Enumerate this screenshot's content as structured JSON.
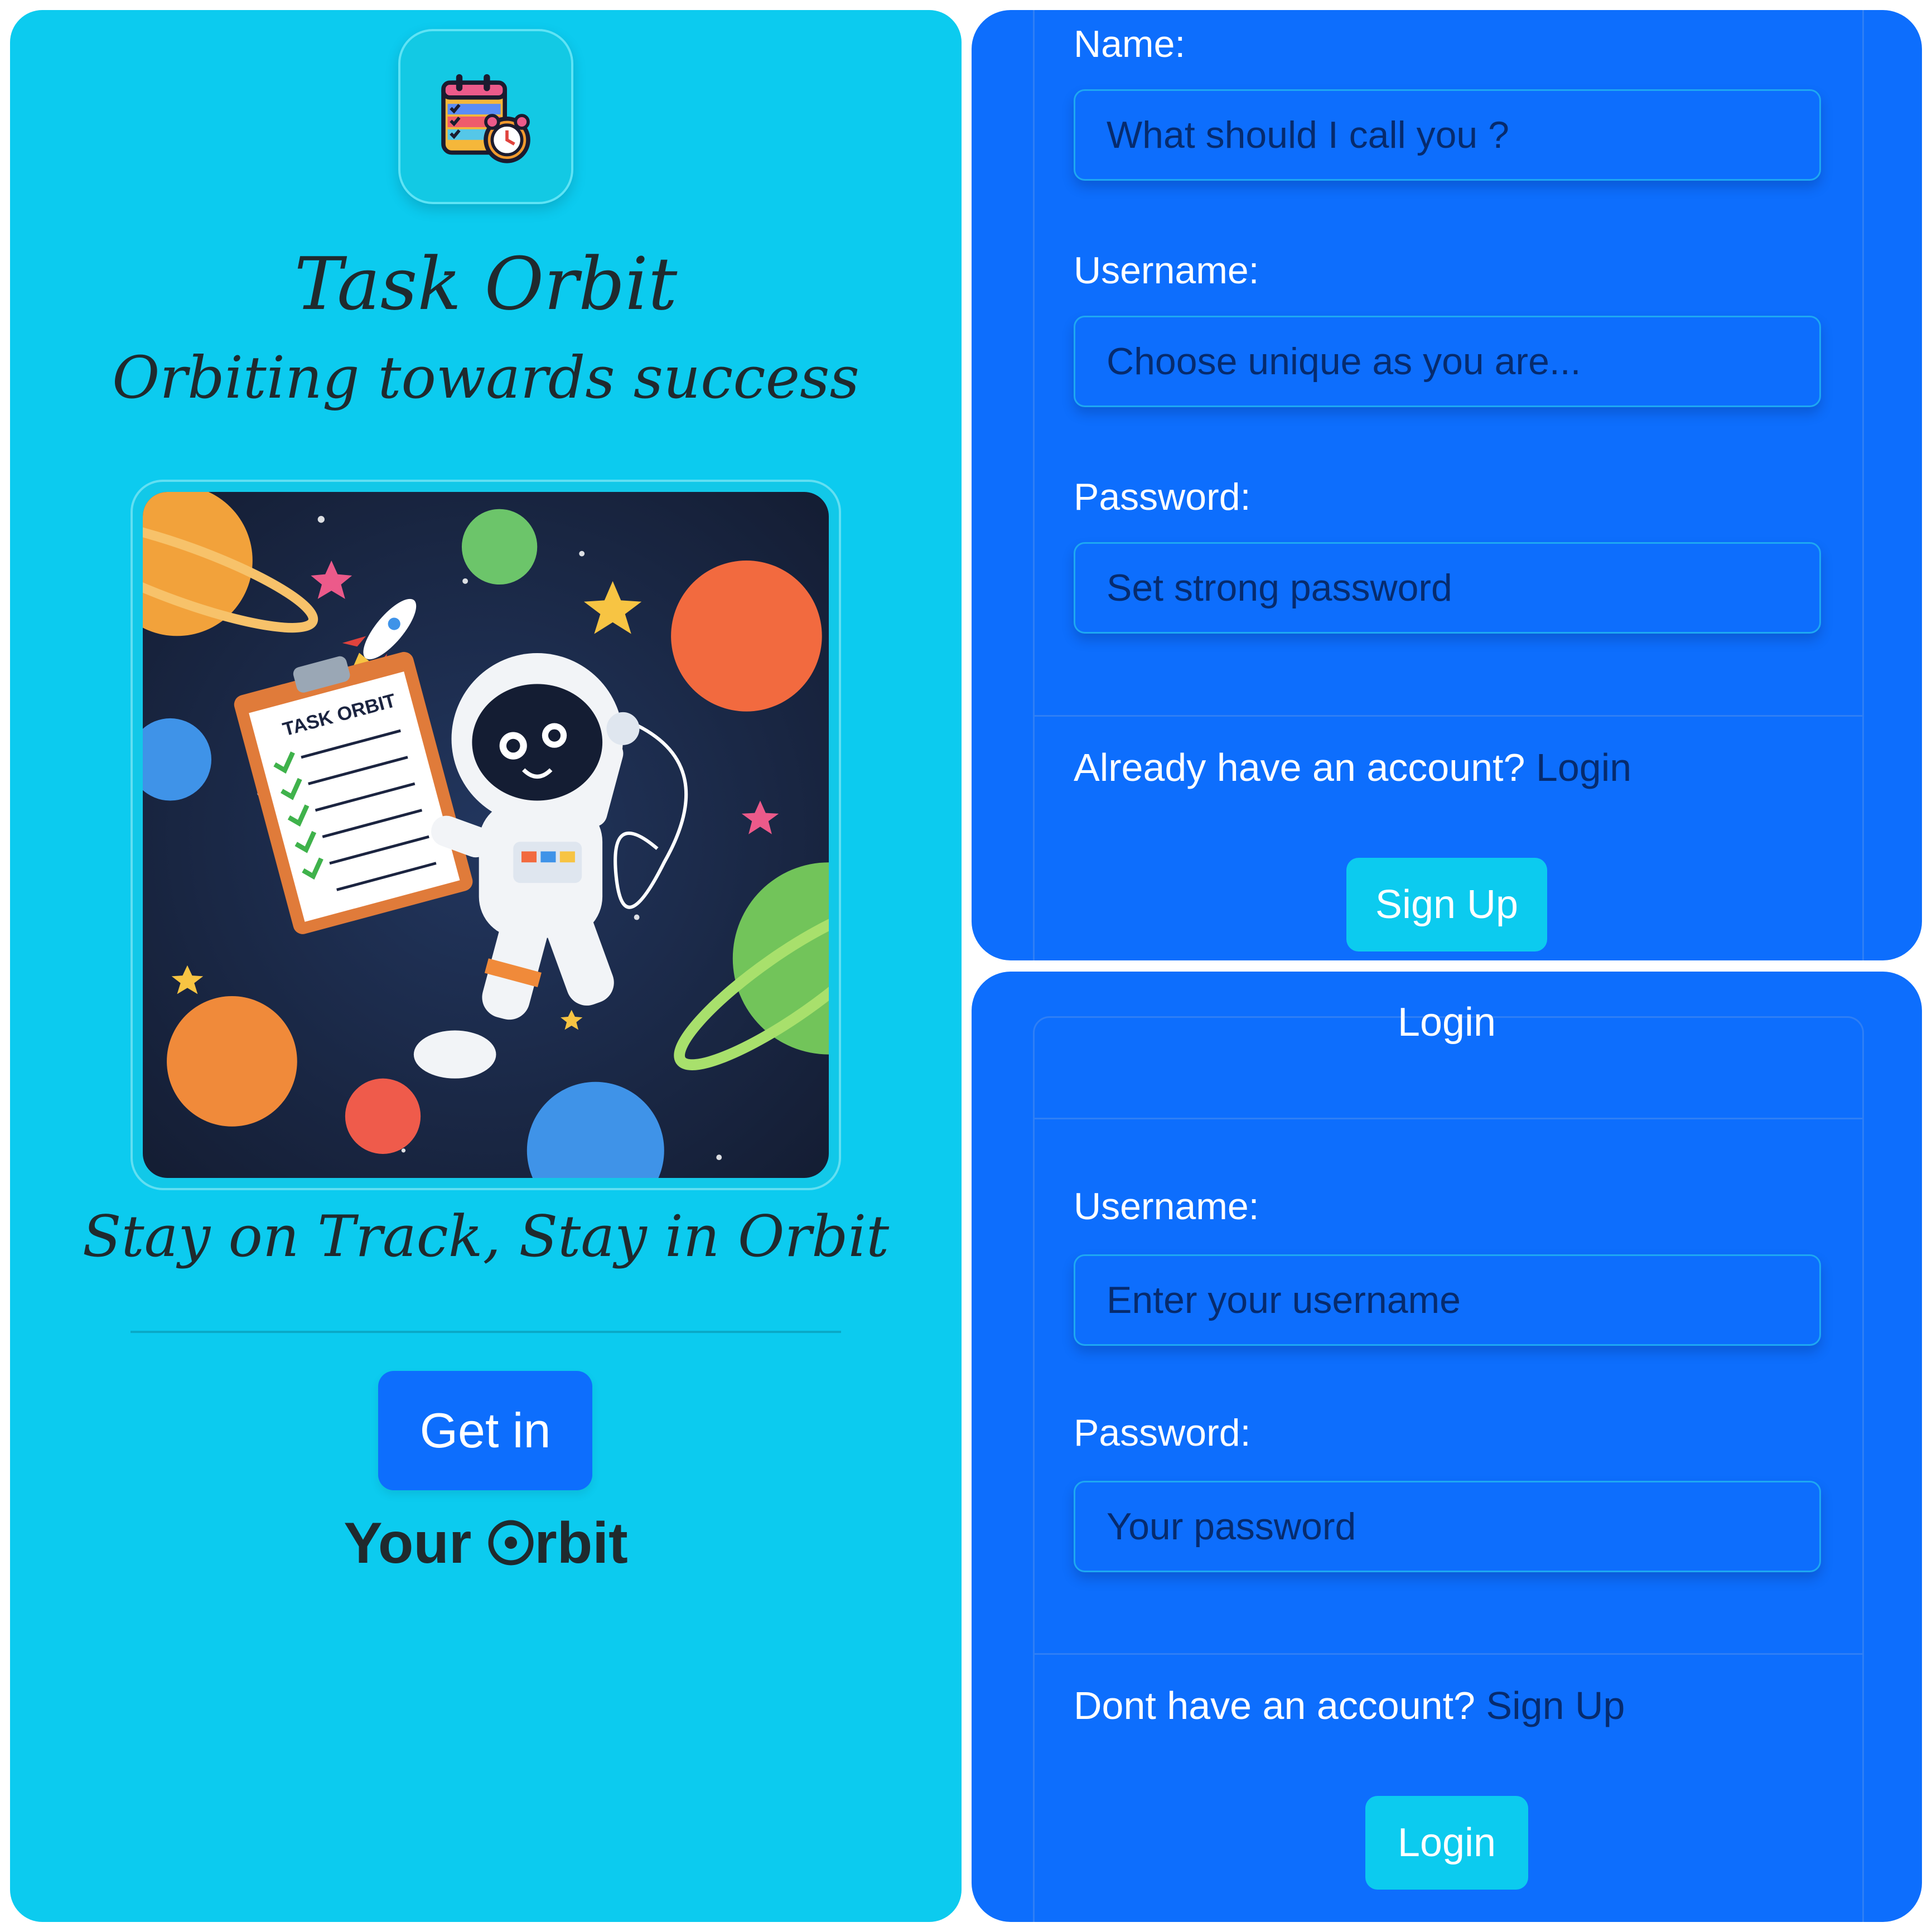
{
  "landing": {
    "title": "Task Orbit",
    "tagline": "Orbiting towards success",
    "clipboard_text": "TASK ORBIT",
    "caption": "Stay on Track, Stay in Orbit",
    "get_in_label": "Get in",
    "your_orbit_prefix": "Your ",
    "your_orbit_suffix": "rbit"
  },
  "signup_form": {
    "name_label": "Name:",
    "name_placeholder": "What should I call you ?",
    "username_label": "Username:",
    "username_placeholder": "Choose unique as you are...",
    "password_label": "Password:",
    "password_placeholder": "Set strong password",
    "account_prompt": "Already have an account?",
    "login_link": "Login",
    "submit_label": "Sign Up"
  },
  "login_form": {
    "header": "Login",
    "username_label": "Username:",
    "username_placeholder": "Enter your username",
    "password_label": "Password:",
    "password_placeholder": "Your password",
    "account_prompt": "Dont have an account?",
    "signup_link": "Sign Up",
    "submit_label": "Login"
  },
  "icons": {
    "app_logo": "calendar-alarm-clock-icon",
    "orbit_o": "target-circle-icon"
  },
  "colors": {
    "landing_bg": "#0ccbef",
    "form_bg": "#0d6efd",
    "accent_button": "#0ccbef",
    "primary_button": "#0d6efd",
    "link": "#062b6e"
  }
}
